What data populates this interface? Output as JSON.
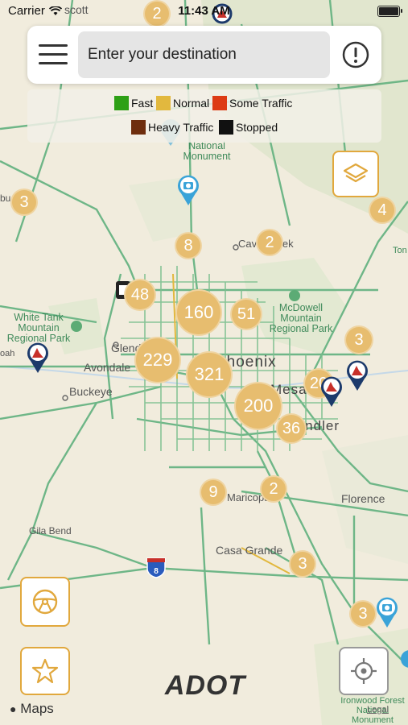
{
  "status_bar": {
    "carrier": "Carrier",
    "time": "11:43 AM"
  },
  "search": {
    "placeholder": "Enter your destination"
  },
  "legend": {
    "items": [
      {
        "label": "Fast",
        "color": "#2ea016"
      },
      {
        "label": "Normal",
        "color": "#e2b83e"
      },
      {
        "label": "Some Traffic",
        "color": "#dd3b14"
      },
      {
        "label": "Heavy Traffic",
        "color": "#6e2d0d"
      },
      {
        "label": "Stopped",
        "color": "#111111"
      }
    ]
  },
  "map": {
    "clusters": [
      "2",
      "3",
      "4",
      "8",
      "2",
      "48",
      "160",
      "51",
      "3",
      "229",
      "321",
      "200",
      "20",
      "36",
      "9",
      "2",
      "3",
      "3"
    ],
    "labels": {
      "top_city": "scott",
      "monument": "National Monument",
      "cave_creek": "Cave Creek",
      "mcdowell": "McDowell Mountain Regional Park",
      "white_tank": "White Tank Mountain Regional Park",
      "glendale": "Glendale",
      "avondale": "Avondale",
      "buckeye": "Buckeye",
      "phoenix": "Phoenix",
      "mesa": "Mesa",
      "chandler": "Chandler",
      "florence": "Florence",
      "maricopa": "Maricopa",
      "gila_bend": "Gila Bend",
      "casa_grande": "Casa Grande",
      "ironwood": "Ironwood Forest National Monument",
      "tonto": "Ton",
      "left_edge": "bu",
      "left_edge2": "oah",
      "interstate_8": "8"
    }
  },
  "branding": {
    "logo_text": "ADOT",
    "maps_attribution": "Maps",
    "legal": "Legal"
  },
  "icons": {
    "menu": "hamburger-menu-icon",
    "info": "info-icon",
    "layers": "layers-icon",
    "steering": "steering-wheel-icon",
    "favorites": "star-icon",
    "locate": "crosshair-icon",
    "camera": "camera-pin-icon",
    "incident": "incident-pin-icon"
  }
}
